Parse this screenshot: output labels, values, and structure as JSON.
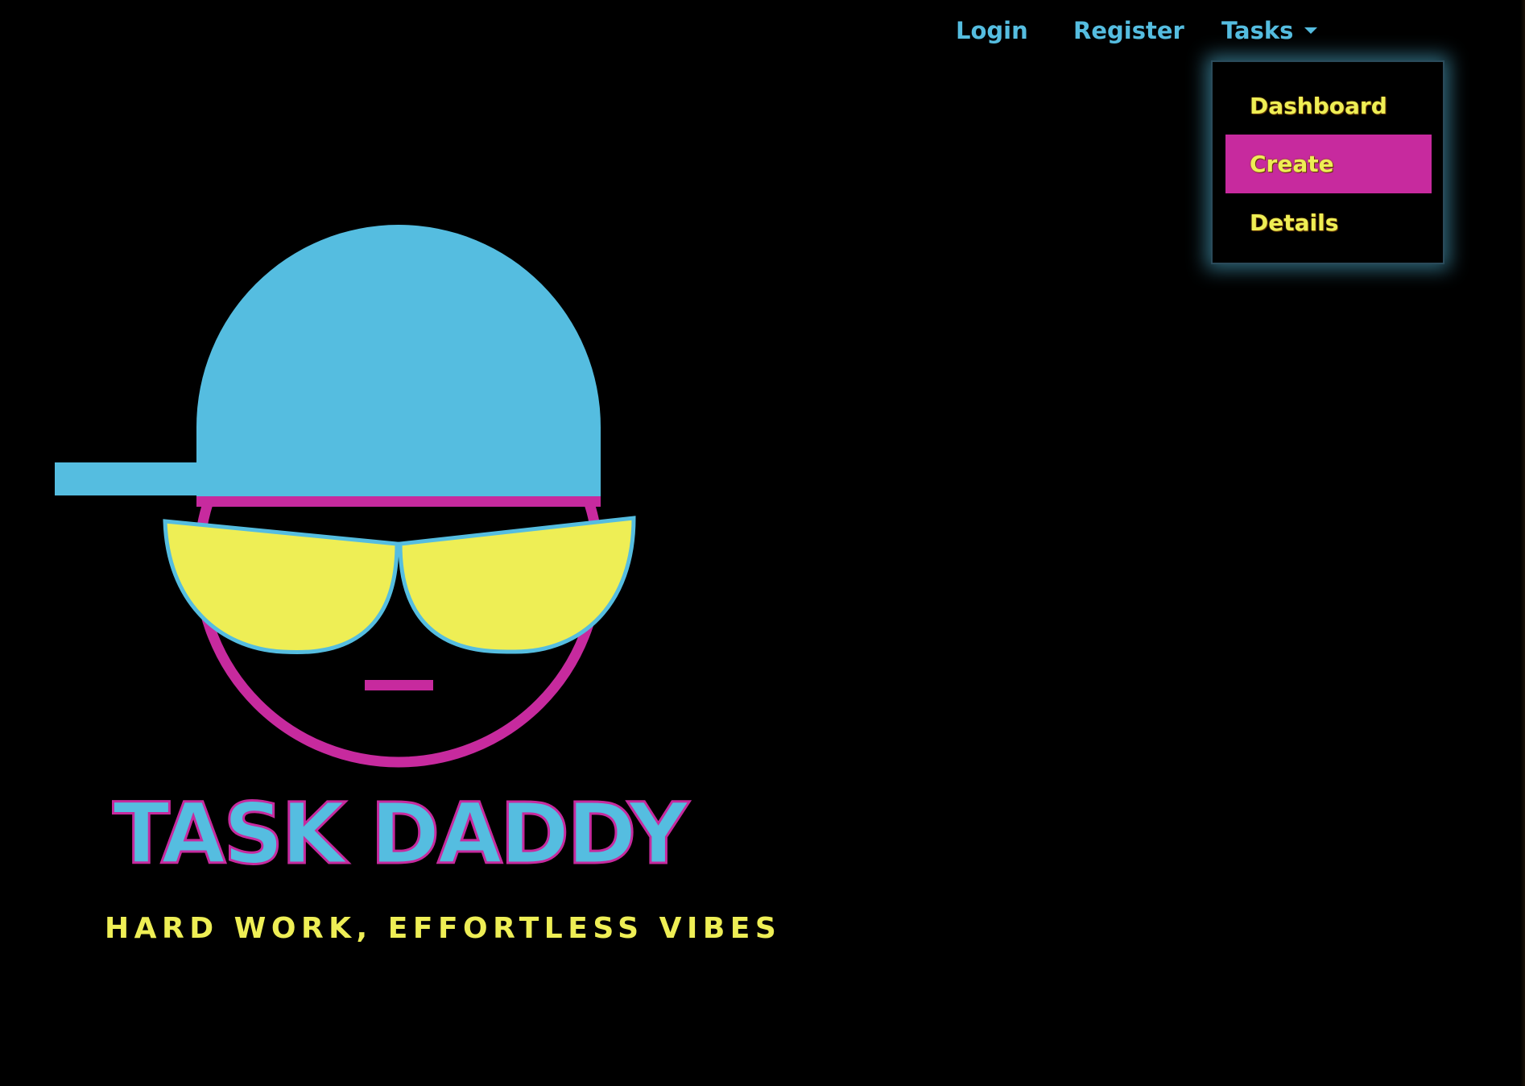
{
  "nav": {
    "login_label": "Login",
    "register_label": "Register",
    "tasks_label": "Tasks"
  },
  "tasks_menu": {
    "items": [
      {
        "label": "Dashboard",
        "highlighted": false
      },
      {
        "label": "Create",
        "highlighted": true
      },
      {
        "label": "Details",
        "highlighted": false
      }
    ]
  },
  "brand": {
    "title": "TASK DADDY",
    "tagline": "HARD WORK, EFFORTLESS VIBES"
  },
  "colors": {
    "background": "#000000",
    "nav_link": "#55bde0",
    "menu_text": "#eeee55",
    "menu_highlight": "#c72a9e",
    "logo_cap": "#55bde0",
    "logo_face_outline": "#c72a9e",
    "logo_glasses": "#eeee55"
  },
  "icons": {
    "tasks_caret": "caret-down-icon",
    "logo": "cool-guy-cap-sunglasses-logo"
  }
}
